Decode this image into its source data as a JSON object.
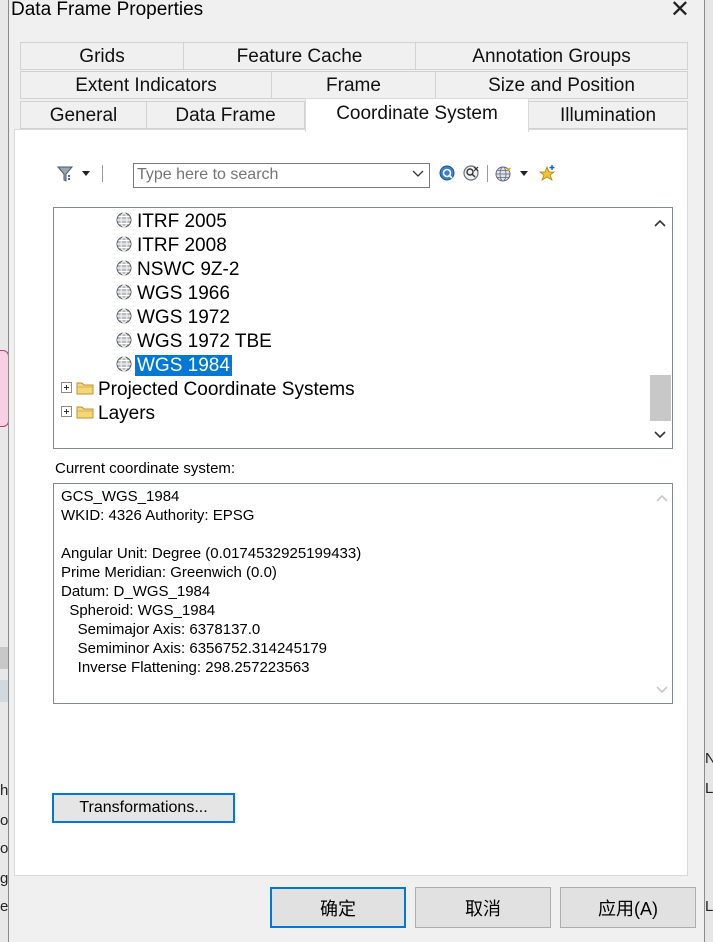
{
  "window": {
    "title": "Data Frame Properties",
    "close_symbol": "✕"
  },
  "tabs": {
    "row1": [
      "Grids",
      "Feature Cache",
      "Annotation Groups"
    ],
    "row2": [
      "Extent Indicators",
      "Frame",
      "Size and Position"
    ],
    "row3": [
      "General",
      "Data Frame",
      "Coordinate System",
      "Illumination"
    ],
    "active": "Coordinate System"
  },
  "toolbar": {
    "filter_icon": "filter-icon",
    "search_placeholder": "Type here to search",
    "search_value": "",
    "search_button_icon": "search-icon",
    "clear_search_icon": "clear-search-icon",
    "add_coordinate_system_icon": "globe-dropdown-icon",
    "favorites_icon": "add-favorite-icon"
  },
  "tree": {
    "items": [
      {
        "label": "ITRF 2005",
        "icon": "globe-icon",
        "selected": false
      },
      {
        "label": "ITRF 2008",
        "icon": "globe-icon",
        "selected": false
      },
      {
        "label": "NSWC 9Z-2",
        "icon": "globe-icon",
        "selected": false
      },
      {
        "label": "WGS 1966",
        "icon": "globe-icon",
        "selected": false
      },
      {
        "label": "WGS 1972",
        "icon": "globe-icon",
        "selected": false
      },
      {
        "label": "WGS 1972 TBE",
        "icon": "globe-icon",
        "selected": false
      },
      {
        "label": "WGS 1984",
        "icon": "globe-icon",
        "selected": true
      }
    ],
    "folders": [
      {
        "label": "Projected Coordinate Systems",
        "icon": "folder-icon"
      },
      {
        "label": "Layers",
        "icon": "folder-icon"
      }
    ]
  },
  "current": {
    "label": "Current coordinate system:",
    "lines": [
      "GCS_WGS_1984",
      "WKID: 4326 Authority: EPSG",
      "",
      "Angular Unit: Degree (0.0174532925199433)",
      "Prime Meridian: Greenwich (0.0)",
      "Datum: D_WGS_1984",
      "  Spheroid: WGS_1984",
      "    Semimajor Axis: 6378137.0",
      "    Semiminor Axis: 6356752.314245179",
      "    Inverse Flattening: 298.257223563"
    ]
  },
  "buttons": {
    "transformations": "Transformations...",
    "ok": "确定",
    "cancel": "取消",
    "apply": "应用(A)"
  },
  "background": {
    "left_letters": [
      "h",
      "o",
      "o",
      "g",
      "e"
    ],
    "right_letters": [
      "N",
      "L",
      "L"
    ]
  },
  "colors": {
    "selection": "#0078d7",
    "focus_border": "#0078d7"
  }
}
